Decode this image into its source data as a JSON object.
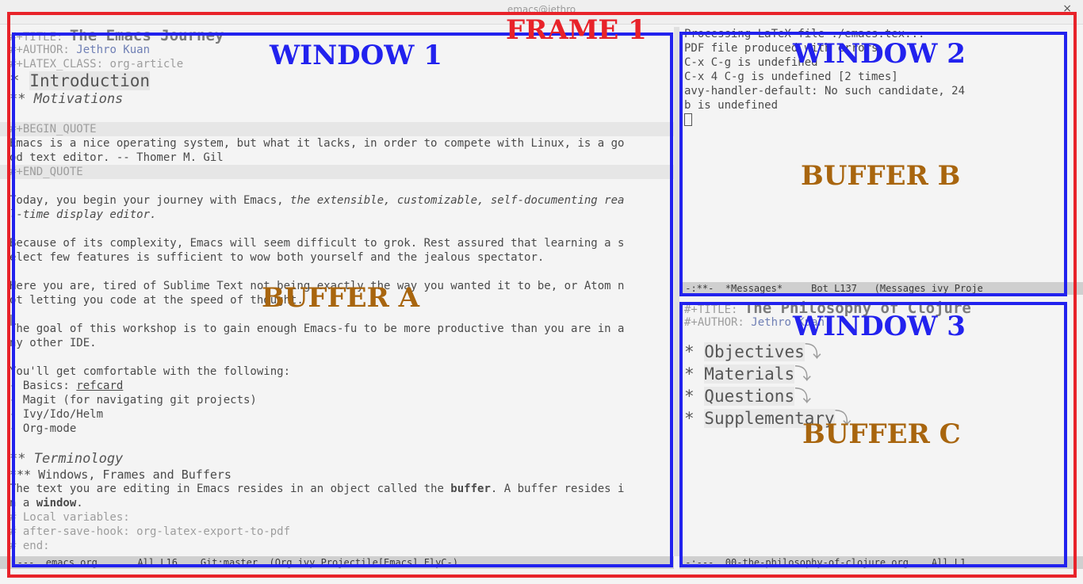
{
  "window_title": "emacs@jethro",
  "close_glyph": "×",
  "window1": {
    "lines": [
      {
        "kw": "#+TITLE: ",
        "val": "The Emacs Journey"
      },
      {
        "kw": "#+AUTHOR: ",
        "val": "Jethro Kuan"
      },
      {
        "kw": "#+LATEX_CLASS: ",
        "val": "org-article"
      }
    ],
    "h1": {
      "star": "* ",
      "text": "Introduction"
    },
    "h2_motivations": "** Motivations",
    "begin_quote": "#+BEGIN_QUOTE",
    "quote_1": "Emacs is a nice operating system, but what it lacks, in order to compete with Linux, is a go",
    "quote_2": "od text editor. -- Thomer M. Gil",
    "end_quote": "#+END_QUOTE",
    "p1_a": "Today, you begin your journey with Emacs, ",
    "p1_b": "the extensible, customizable, self-documenting rea",
    "p1_c": "l-time display editor.",
    "p2_a": "Because of its complexity, Emacs will seem difficult to grok. Rest assured that learning a s",
    "p2_b": "elect few features is sufficient to wow both yourself and the jealous spectator.",
    "p3_a": "Here you are, tired of Sublime Text not being exactly the way you wanted it to be, or Atom n",
    "p3_b": "ot letting you code at the speed of thought.",
    "p4_a": "The goal of this workshop is to gain enough Emacs-fu to be more productive than you are in a",
    "p4_b": "ny other IDE.",
    "p5": "You'll get comfortable with the following:",
    "items": [
      {
        "bullet": "- ",
        "text": "Basics: ",
        "link": "refcard"
      },
      {
        "bullet": "- ",
        "text": "Magit (for navigating git projects)",
        "link": ""
      },
      {
        "bullet": "- ",
        "text": "Ivy/Ido/Helm",
        "link": ""
      },
      {
        "bullet": "- ",
        "text": "Org-mode",
        "link": ""
      }
    ],
    "h2_terminology": "** Terminology",
    "h3_wfb": "*** Windows, Frames and Buffers",
    "p6_a": "The text you are editing in Emacs resides in an object called the ",
    "p6_b": "buffer",
    "p6_c": ". A buffer resides i",
    "p6_d": "n a ",
    "p6_e": "window",
    "p6_f": ".",
    "local_vars": "# Local variables:",
    "after_save": "# after-save-hook: org-latex-export-to-pdf",
    "end": "# end:",
    "modeline": " -:---  emacs.org       All L16    Git:master  (Org ivy Projectile[Emacs] FlyC-) "
  },
  "window2": {
    "lines": [
      "Processing LaTeX file ./emacs.tex...",
      "PDF file produced with errors.",
      "C-x C-g is undefined",
      "C-x 4 C-g is undefined [2 times]",
      "avy-handler-default: No such candidate, 24",
      "b is undefined"
    ],
    "modeline": " -:**-  *Messages*     Bot L137   (Messages ivy Proje"
  },
  "window3": {
    "lines": [
      {
        "kw": "#+TITLE: ",
        "val": "The Philosophy of Clojure"
      },
      {
        "kw": "#+AUTHOR: ",
        "val": "Jethro Kuan"
      }
    ],
    "headings": [
      {
        "star": "* ",
        "text": "Objectives",
        "fold": "⤵"
      },
      {
        "star": "* ",
        "text": "Materials",
        "fold": "⤵"
      },
      {
        "star": "* ",
        "text": "Questions",
        "fold": "⤵"
      },
      {
        "star": "* ",
        "text": "Supplementary",
        "fold": "⤵"
      }
    ],
    "modeline": " -:---  00-the-philosophy-of-clojure.org    All L1 "
  },
  "annotations": {
    "frame1": "FRAME 1",
    "window1": "WINDOW 1",
    "window2": "WINDOW 2",
    "window3": "WINDOW 3",
    "bufferA": "BUFFER A",
    "bufferB": "BUFFER B",
    "bufferC": "BUFFER C",
    "frame_color": "#e8232a",
    "window_color": "#2222ee",
    "buffer_color": "#a8650e"
  }
}
